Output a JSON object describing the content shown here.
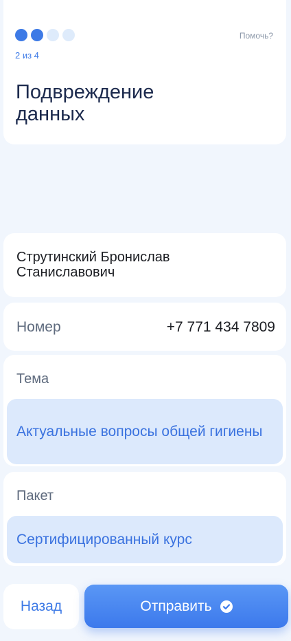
{
  "header": {
    "steps_total": 4,
    "steps_done": 2,
    "step_label": "2 из 4",
    "help_label": "Помочь?",
    "title": "Подвреждение данных"
  },
  "person": {
    "full_name": "Струтинский Бронислав Станиславович"
  },
  "phone": {
    "label": "Номер",
    "value": "+7 771 434 7809"
  },
  "topic": {
    "label": "Тема",
    "value": "Актуальные вопросы общей гигиены"
  },
  "package": {
    "label": "Пакет",
    "value": "Сертифицированный курс"
  },
  "actions": {
    "back_label": "Назад",
    "submit_label": "Отправить",
    "submit_icon": "check-circle-icon"
  },
  "colors": {
    "accent": "#3d7ae6",
    "background": "#f1f6fd",
    "select_bg": "#dce9fc"
  }
}
